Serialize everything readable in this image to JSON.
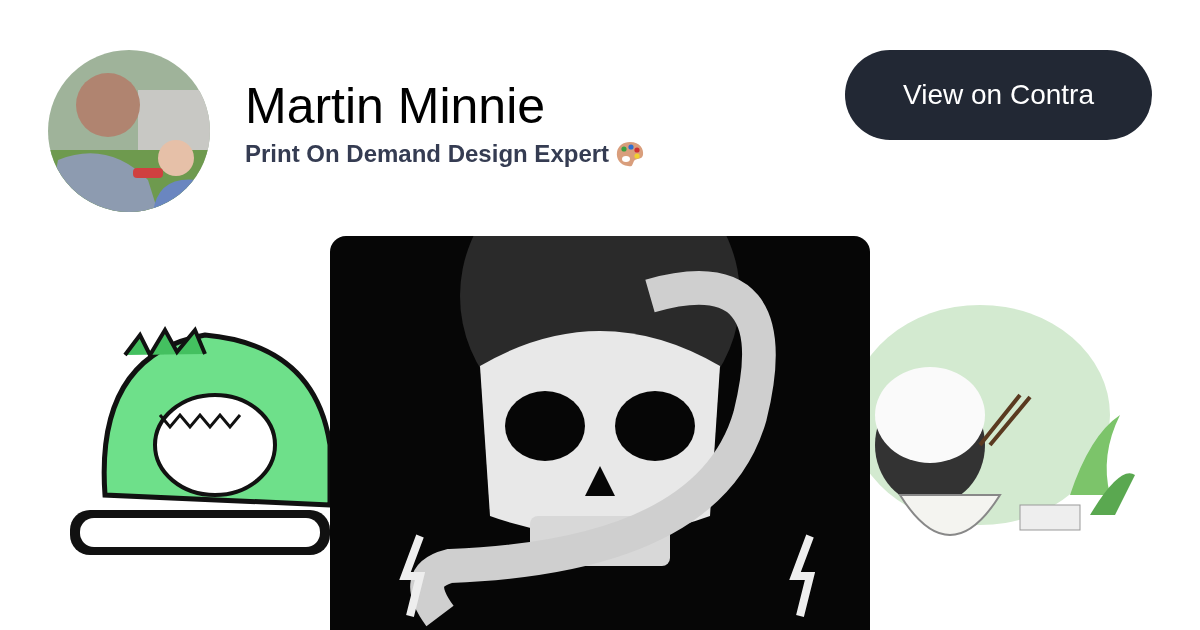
{
  "profile": {
    "name": "Martin Minnie",
    "headline": "Print On Demand Design Expert"
  },
  "action": {
    "label": "View on Contra"
  }
}
